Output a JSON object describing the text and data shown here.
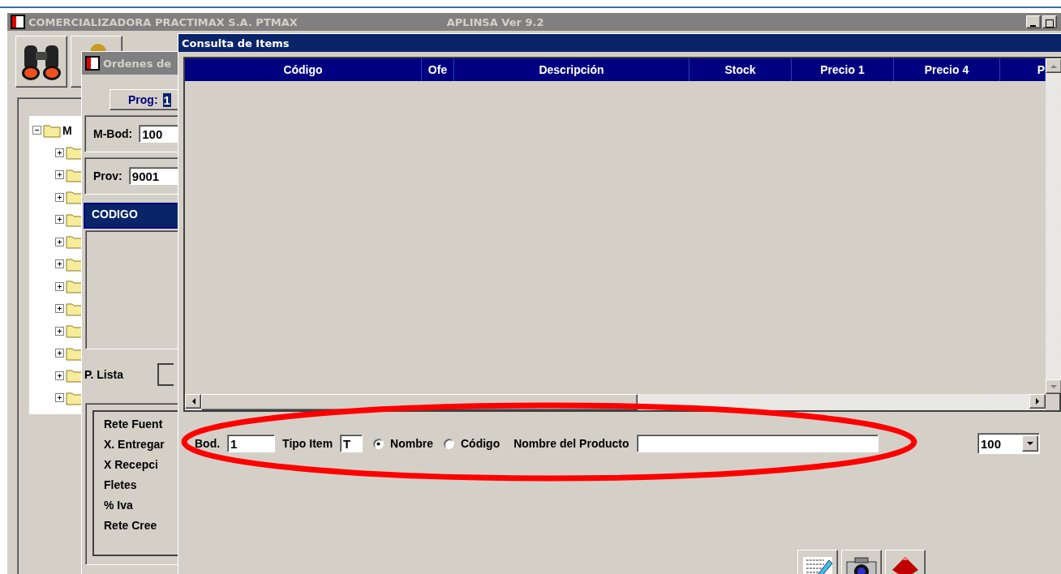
{
  "main_window": {
    "title": "COMERCIALIZADORA PRACTIMAX S.A.  PTMAX",
    "version": "APLINSA Ver 9.2",
    "toolbar": [
      {
        "kind": "binoculars"
      },
      {
        "kind": "person"
      }
    ]
  },
  "tree": {
    "label": "M",
    "expanded": true,
    "children": [
      {
        "expanded": false
      },
      {
        "expanded": false
      },
      {
        "expanded": false
      },
      {
        "expanded": false
      },
      {
        "expanded": false
      },
      {
        "expanded": false
      },
      {
        "expanded": false
      },
      {
        "expanded": false
      },
      {
        "expanded": false
      },
      {
        "expanded": false
      },
      {
        "expanded": false
      },
      {
        "expanded": false
      }
    ]
  },
  "orders_window": {
    "title": "Ordenes de",
    "prog_label": "Prog:",
    "prog_value": "1",
    "m_bod_label": "M-Bod:",
    "m_bod_value": "100",
    "prov_label": "Prov:",
    "prov_value": "9001",
    "list_header": "CODIGO",
    "p_lista_label": "P. Lista",
    "totals": [
      "Rete Fuent",
      "X. Entregar",
      "X  Recepci",
      "Fletes",
      "% Iva",
      "Rete Cree"
    ]
  },
  "items_window": {
    "title": "Consulta de Items",
    "table": {
      "columns": [
        "Código",
        "Ofe",
        "Descripción",
        "Stock",
        "Precio 1",
        "Precio 4",
        "P"
      ]
    },
    "filters": {
      "bod_label": "Bod.",
      "bod_value": "1",
      "tipo_label": "Tipo Item",
      "tipo_value": "T",
      "search_by": [
        {
          "label": "Nombre",
          "selected": true
        },
        {
          "label": "Código",
          "selected": false
        }
      ],
      "product_label": "Nombre del Producto",
      "limit": "100"
    },
    "tools": [
      {
        "kind": "edit"
      },
      {
        "kind": "camera"
      },
      {
        "kind": "pyramid"
      }
    ]
  },
  "annotation": {
    "kind": "ellipse",
    "color": "#ff0000"
  }
}
